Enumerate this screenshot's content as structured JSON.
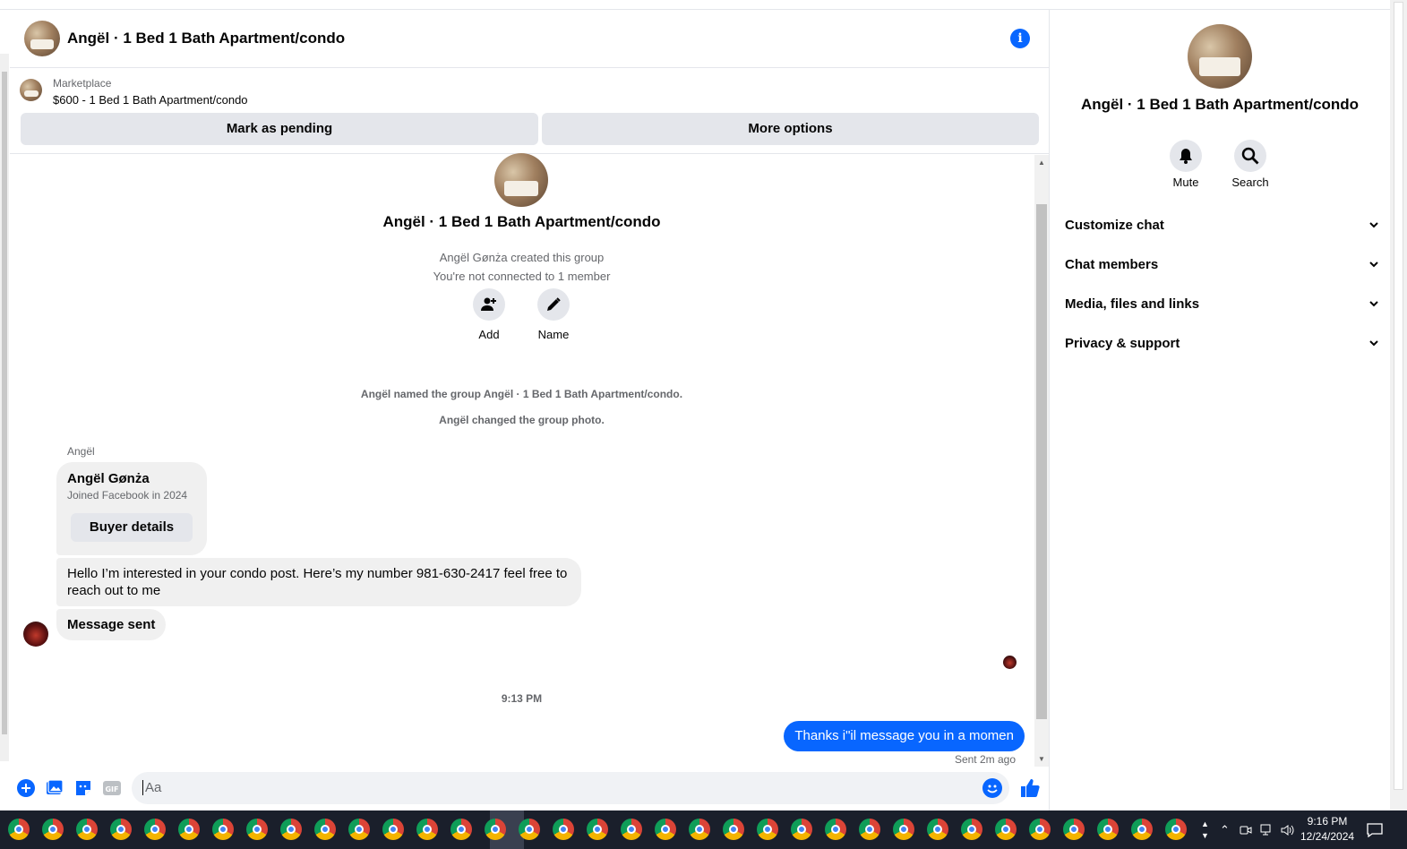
{
  "header": {
    "title": "Angël · 1 Bed 1 Bath Apartment/condo"
  },
  "marketplace": {
    "label": "Marketplace",
    "item": "$600 - 1 Bed 1 Bath Apartment/condo",
    "mark_pending_label": "Mark as pending",
    "more_options_label": "More options"
  },
  "group": {
    "title": "Angël · 1 Bed 1 Bath Apartment/condo",
    "created_by": "Angël Gønża created this group",
    "not_connected": "You're not connected to 1 member",
    "add_label": "Add",
    "name_label": "Name"
  },
  "system_messages": [
    "Angël named the group Angël · 1 Bed 1 Bath Apartment/condo.",
    "Angël changed the group photo."
  ],
  "conversation": {
    "sender_name": "Angël",
    "buyer_card": {
      "name": "Angël Gønża",
      "joined": "Joined Facebook in 2024",
      "button_label": "Buyer details"
    },
    "incoming": [
      "Hello I’m interested in your condo post. Here’s my number 981-630-2417 feel free to reach out to me",
      "Message sent"
    ],
    "timestamp": "9:13 PM",
    "outgoing": "Thanks i\"il message you in a momen",
    "status": "Sent 2m ago"
  },
  "composer": {
    "placeholder": "Aa",
    "gif_label": "GIF"
  },
  "sidebar": {
    "title": "Angël · 1 Bed 1 Bath Apartment/condo",
    "mute_label": "Mute",
    "search_label": "Search",
    "sections": [
      "Customize chat",
      "Chat members",
      "Media, files and links",
      "Privacy & support"
    ]
  },
  "taskbar": {
    "time": "9:16 PM",
    "date": "12/24/2024"
  },
  "colors": {
    "accent": "#0866ff",
    "bubble_in": "#f0f0f0",
    "button": "#e4e6eb",
    "taskbar": "#1a1f2b"
  }
}
